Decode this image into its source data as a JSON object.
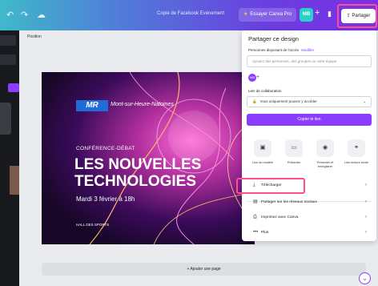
{
  "topbar": {
    "title": "Copie de Facebook Évènement",
    "pro_label": "Essayer Canva Pro",
    "avatar_initials": "MB",
    "share_label": "Partager"
  },
  "canvas": {
    "page_label": "Position",
    "add_page_label": "+ Ajouter une page"
  },
  "design": {
    "logo": "MR",
    "subtitle": "Mont-sur-Heure-Natoines",
    "kicker": "CONFÉRENCE-DÉBAT",
    "title_line1": "LES NOUVELLES",
    "title_line2": "TECHNOLOGIES",
    "date": "Mardi 3 février à 18h",
    "venue": "HALL DES SPORTS"
  },
  "share_panel": {
    "title": "Partager ce design",
    "people_label": "Personnes disposant de l'accès",
    "modify_label": "Modifier",
    "search_placeholder": "Ajoutez des personnes, des groupes ou votre équipe",
    "avatar_initials": "MB",
    "collab_label": "Lien de collaboration",
    "collab_value": "Vous uniquement pouvez y accéder",
    "copy_link_label": "Copier le lien",
    "actions": [
      {
        "icon": "template-icon",
        "glyph": "▣",
        "label": "Lien du modèle"
      },
      {
        "icon": "present-icon",
        "glyph": "▭",
        "label": "Présenter"
      },
      {
        "icon": "record-icon",
        "glyph": "◉",
        "label": "Présenter et enregistrer"
      },
      {
        "icon": "link-icon",
        "glyph": "⚭",
        "label": "Lien lecture seule"
      }
    ],
    "rows": [
      {
        "icon": "download-icon",
        "glyph": "⤓",
        "label": "Télécharger"
      },
      {
        "icon": "social-icon",
        "glyph": "▤",
        "label": "Partager sur les réseaux sociaux"
      },
      {
        "icon": "print-icon",
        "glyph": "⎙",
        "label": "Imprimez avec Canva"
      },
      {
        "icon": "more-icon",
        "glyph": "•••",
        "label": "Plus"
      }
    ]
  },
  "colors": {
    "accent": "#8b3dff",
    "highlight": "#ff4f8f"
  }
}
